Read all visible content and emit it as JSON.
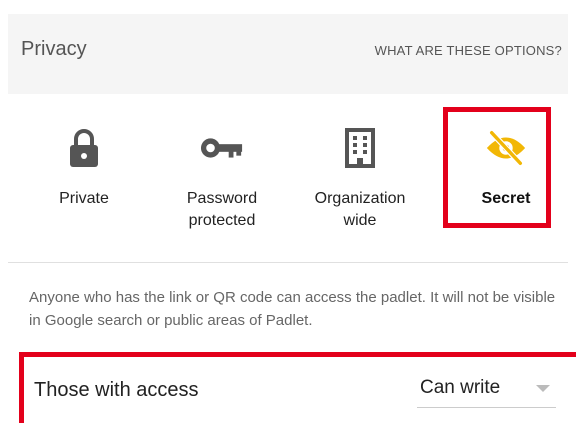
{
  "privacy": {
    "title": "Privacy",
    "help_link": "WHAT ARE THESE OPTIONS?",
    "options": [
      {
        "label": "Private",
        "icon": "lock-icon",
        "selected": false
      },
      {
        "label": "Password\nprotected",
        "icon": "key-icon",
        "selected": false
      },
      {
        "label": "Organization\nwide",
        "icon": "building-icon",
        "selected": false
      },
      {
        "label": "Secret",
        "icon": "eye-off-icon",
        "selected": true
      }
    ],
    "description": "Anyone who has the link or QR code can access the padlet. It will not be visible in Google search or public areas of Padlet."
  },
  "access": {
    "label": "Those with access",
    "value": "Can write"
  },
  "colors": {
    "icon_gray": "#555555",
    "secret_accent": "#f2b705",
    "highlight_red": "#e3001b",
    "header_bg": "#f5f5f5"
  }
}
